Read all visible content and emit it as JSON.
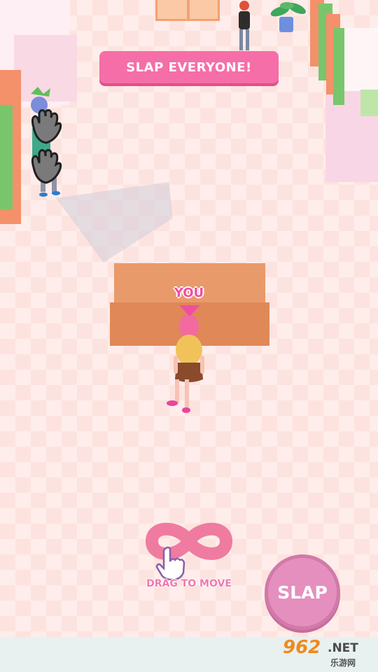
{
  "hud": {
    "objective": "SLAP EVERYONE!",
    "player_marker": "YOU",
    "drag_hint": "DRAG TO MOVE",
    "slap_label": "SLAP"
  },
  "watermark": {
    "number": "962",
    "domain": ".NET",
    "chinese": "乐游网"
  },
  "colors": {
    "accent_pink": "#f56ea8",
    "slap_button": "#e58fbf",
    "box_orange": "#e08858",
    "floor": "#fde3df"
  }
}
